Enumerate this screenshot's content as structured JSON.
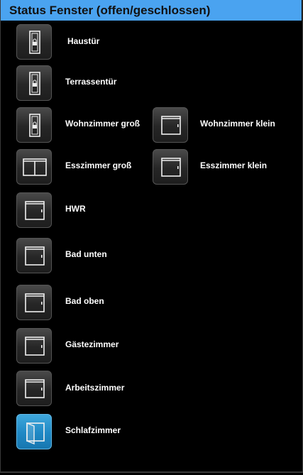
{
  "header": {
    "title": "Status Fenster (offen/geschlossen)"
  },
  "windows": [
    {
      "label": "Haustür",
      "state": "door-locked",
      "icon": "door-lock-icon"
    },
    {
      "label": "Terrassentür",
      "state": "door-locked",
      "icon": "door-lock-icon"
    },
    {
      "label": "Wohnzimmer groß",
      "state": "door-locked",
      "icon": "door-lock-icon"
    },
    {
      "label": "Wohnzimmer klein",
      "state": "closed",
      "icon": "window-closed-icon"
    },
    {
      "label": "Esszimmer groß",
      "state": "closed-double",
      "icon": "window-double-closed-icon"
    },
    {
      "label": "Esszimmer klein",
      "state": "closed",
      "icon": "window-closed-icon"
    },
    {
      "label": "HWR",
      "state": "closed",
      "icon": "window-closed-icon"
    },
    {
      "label": "Bad unten",
      "state": "closed",
      "icon": "window-closed-icon"
    },
    {
      "label": "Bad oben",
      "state": "closed",
      "icon": "window-closed-icon"
    },
    {
      "label": "Gästezimmer",
      "state": "closed",
      "icon": "window-closed-icon"
    },
    {
      "label": "Arbeitszimmer",
      "state": "closed",
      "icon": "window-closed-icon"
    },
    {
      "label": "Schlafzimmer",
      "state": "open",
      "icon": "window-open-icon"
    }
  ],
  "colors": {
    "header": "#4aa3f0",
    "open_tile": "#1f88c4",
    "closed_tile": "#2a2a2a"
  }
}
